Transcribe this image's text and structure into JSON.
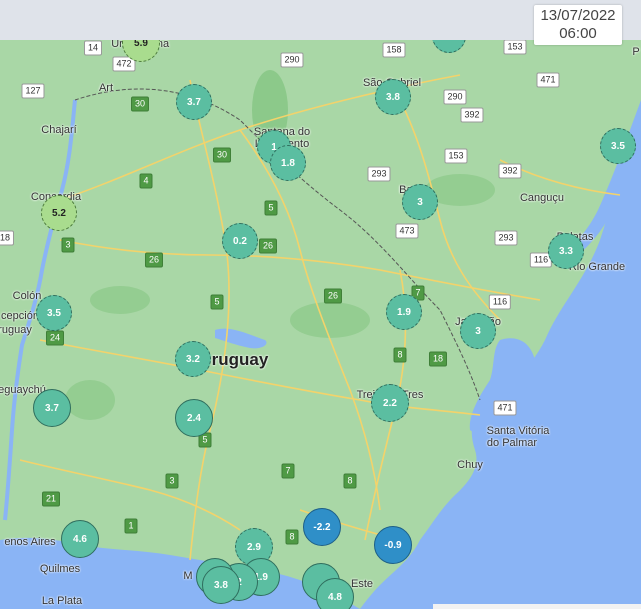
{
  "timestamp": {
    "date": "13/07/2022",
    "time": "06:00"
  },
  "labels": [
    {
      "id": "uruguay",
      "text": "ruguay",
      "big": true
    },
    {
      "id": "chajari",
      "text": "Chajarí"
    },
    {
      "id": "concordia",
      "text": "Concordia"
    },
    {
      "id": "colon",
      "text": "Colón"
    },
    {
      "id": "concepcion",
      "text": "cepción"
    },
    {
      "id": "uruguay-ar",
      "text": "ruguay"
    },
    {
      "id": "gualeguaychu",
      "text": "eguaychú"
    },
    {
      "id": "santana",
      "text": "Santana do"
    },
    {
      "id": "livramento",
      "text": "Livramento"
    },
    {
      "id": "sao-gabriel",
      "text": "São Gabriel"
    },
    {
      "id": "bage",
      "text": "Bagé"
    },
    {
      "id": "cangucu",
      "text": "Canguçu"
    },
    {
      "id": "pelotas",
      "text": "Pelotas"
    },
    {
      "id": "rio-grande",
      "text": "Rio Grande"
    },
    {
      "id": "jaguarao",
      "text": "Jaguarão"
    },
    {
      "id": "treinta-y-tres",
      "text": "Treinta y Tres"
    },
    {
      "id": "santa-vitoria",
      "text": "Santa Vitória"
    },
    {
      "id": "do-palmar",
      "text": "do Palmar"
    },
    {
      "id": "chuy",
      "text": "Chuy"
    },
    {
      "id": "buenos-aires",
      "text": "enos Aires"
    },
    {
      "id": "quilmes",
      "text": "Quilmes"
    },
    {
      "id": "la-plata",
      "text": "La Plata"
    },
    {
      "id": "montevideo",
      "text": "M"
    },
    {
      "id": "punta-del-este",
      "text": "Este"
    },
    {
      "id": "uruguaiana",
      "text": "Ur"
    },
    {
      "id": "alegrete",
      "text": "na"
    },
    {
      "id": "artigas",
      "text": "Art"
    },
    {
      "id": "p-edge",
      "text": "P"
    }
  ],
  "shields": [
    {
      "id": "r14",
      "text": "14",
      "style": "white"
    },
    {
      "id": "r472",
      "text": "472",
      "style": "white"
    },
    {
      "id": "r127",
      "text": "127",
      "style": "white"
    },
    {
      "id": "r290a",
      "text": "290",
      "style": "white"
    },
    {
      "id": "r158",
      "text": "158",
      "style": "white"
    },
    {
      "id": "r153a",
      "text": "153",
      "style": "white"
    },
    {
      "id": "r290b",
      "text": "290",
      "style": "white"
    },
    {
      "id": "r392",
      "text": "392",
      "style": "white"
    },
    {
      "id": "r471a",
      "text": "471",
      "style": "white"
    },
    {
      "id": "r153b",
      "text": "153",
      "style": "white"
    },
    {
      "id": "r392b",
      "text": "392",
      "style": "white"
    },
    {
      "id": "r293a",
      "text": "293",
      "style": "white"
    },
    {
      "id": "r473",
      "text": "473",
      "style": "white"
    },
    {
      "id": "r293b",
      "text": "293",
      "style": "white"
    },
    {
      "id": "r116a",
      "text": "116",
      "style": "white"
    },
    {
      "id": "r116b",
      "text": "116",
      "style": "white"
    },
    {
      "id": "r471b",
      "text": "471",
      "style": "white"
    },
    {
      "id": "r18a",
      "text": "18",
      "style": "white"
    },
    {
      "id": "r30a",
      "text": "30",
      "style": "green"
    },
    {
      "id": "r30b",
      "text": "30",
      "style": "green"
    },
    {
      "id": "r4",
      "text": "4",
      "style": "green"
    },
    {
      "id": "r5a",
      "text": "5",
      "style": "green"
    },
    {
      "id": "r26a",
      "text": "26",
      "style": "green"
    },
    {
      "id": "r26b",
      "text": "26",
      "style": "green"
    },
    {
      "id": "r26c",
      "text": "26",
      "style": "green"
    },
    {
      "id": "r3a",
      "text": "3",
      "style": "green"
    },
    {
      "id": "r5b",
      "text": "5",
      "style": "green"
    },
    {
      "id": "r7a",
      "text": "7",
      "style": "green"
    },
    {
      "id": "r8a",
      "text": "8",
      "style": "green"
    },
    {
      "id": "r18b",
      "text": "18",
      "style": "green"
    },
    {
      "id": "r24",
      "text": "24",
      "style": "green"
    },
    {
      "id": "r5c",
      "text": "5",
      "style": "green"
    },
    {
      "id": "r7b",
      "text": "7",
      "style": "green"
    },
    {
      "id": "r3b",
      "text": "3",
      "style": "green"
    },
    {
      "id": "r8b",
      "text": "8",
      "style": "green"
    },
    {
      "id": "r21",
      "text": "21",
      "style": "green"
    },
    {
      "id": "r1",
      "text": "1",
      "style": "green"
    },
    {
      "id": "r8c",
      "text": "8",
      "style": "green"
    },
    {
      "id": "r9",
      "text": "9",
      "style": "green"
    }
  ],
  "markers": [
    {
      "id": "m-59",
      "value": "5.9",
      "color": "lightg"
    },
    {
      "id": "m-37a",
      "value": "3.7",
      "color": "teal"
    },
    {
      "id": "m-38a",
      "value": "3.8",
      "color": "teal"
    },
    {
      "id": "m-35a",
      "value": "3.5",
      "color": "teal"
    },
    {
      "id": "m-18",
      "value": "1.8",
      "color": "teal"
    },
    {
      "id": "m-1x",
      "value": "1",
      "color": "teal"
    },
    {
      "id": "m-52",
      "value": "5.2",
      "color": "lightg"
    },
    {
      "id": "m-3a",
      "value": "3",
      "color": "teal"
    },
    {
      "id": "m-02",
      "value": "0.2",
      "color": "teal"
    },
    {
      "id": "m-33",
      "value": "3.3",
      "color": "teal"
    },
    {
      "id": "m-35b",
      "value": "3.5",
      "color": "teal"
    },
    {
      "id": "m-19a",
      "value": "1.9",
      "color": "teal"
    },
    {
      "id": "m-3b",
      "value": "3",
      "color": "teal"
    },
    {
      "id": "m-32",
      "value": "3.2",
      "color": "teal"
    },
    {
      "id": "m-37b",
      "value": "3.7",
      "color": "teal"
    },
    {
      "id": "m-24",
      "value": "2.4",
      "color": "teal"
    },
    {
      "id": "m-22",
      "value": "2.2",
      "color": "teal"
    },
    {
      "id": "m-neg22",
      "value": "-2.2",
      "color": "blue"
    },
    {
      "id": "m-neg09",
      "value": "-0.9",
      "color": "blue"
    },
    {
      "id": "m-46",
      "value": "4.6",
      "color": "teal"
    },
    {
      "id": "m-29",
      "value": "2.9",
      "color": "teal"
    },
    {
      "id": "m-19b",
      "value": "1.9",
      "color": "teal"
    },
    {
      "id": "m-2x",
      "value": "2",
      "color": "teal"
    },
    {
      "id": "m-38b",
      "value": "3.8",
      "color": "teal"
    },
    {
      "id": "m-48",
      "value": "4.8",
      "color": "teal"
    },
    {
      "id": "m-top",
      "value": "",
      "color": "teal"
    },
    {
      "id": "m-pde",
      "value": "",
      "color": "teal"
    }
  ]
}
